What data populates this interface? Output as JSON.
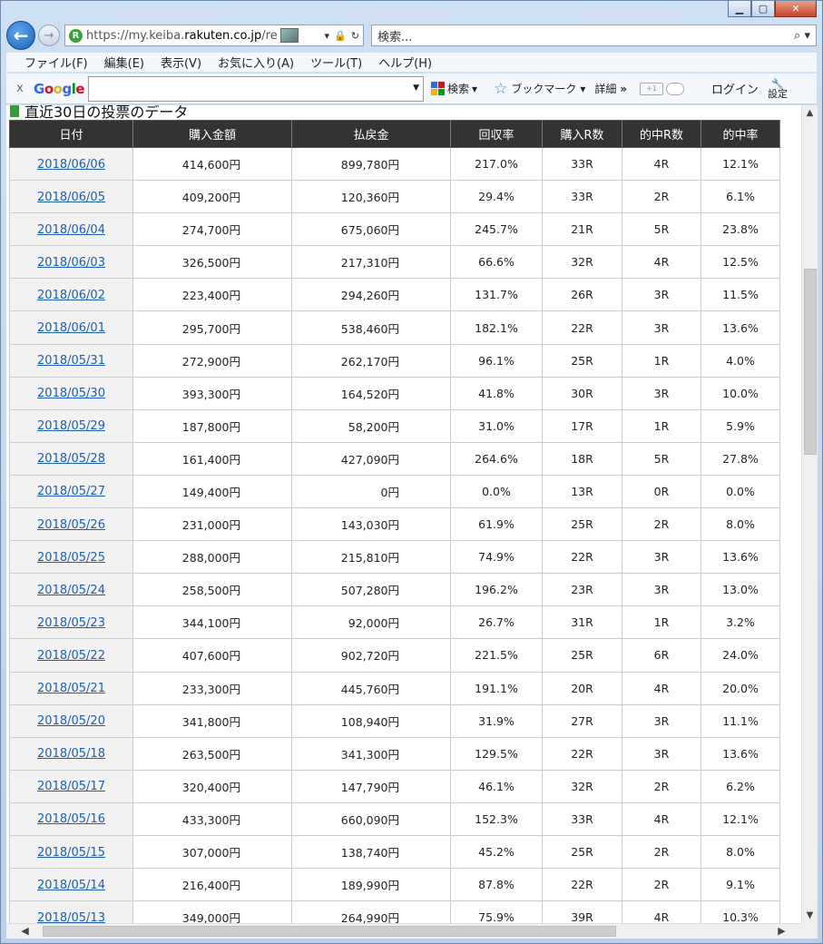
{
  "browser": {
    "url_prefix": "https://my.keiba.",
    "url_domain": "rakuten.co.jp",
    "url_suffix": "/rece",
    "search_placeholder": "検索...",
    "menu": [
      "ファイル(F)",
      "編集(E)",
      "表示(V)",
      "お気に入り(A)",
      "ツール(T)",
      "ヘルプ(H)"
    ],
    "toolbar": {
      "close": "x",
      "search_label": "検索",
      "bookmark_label": "ブックマーク",
      "details_label": "詳細",
      "more": "»",
      "plus_label": "+1",
      "login_label": "ログイン",
      "settings_label": "設定"
    }
  },
  "page": {
    "section_title": "直近30日の投票のデータ",
    "columns": [
      "日付",
      "購入金額",
      "払戻金",
      "回収率",
      "購入R数",
      "的中R数",
      "的中率"
    ],
    "rows": [
      [
        "2018/06/06",
        "414,600円",
        "899,780円",
        "217.0%",
        "33R",
        "4R",
        "12.1%"
      ],
      [
        "2018/06/05",
        "409,200円",
        "120,360円",
        "29.4%",
        "33R",
        "2R",
        "6.1%"
      ],
      [
        "2018/06/04",
        "274,700円",
        "675,060円",
        "245.7%",
        "21R",
        "5R",
        "23.8%"
      ],
      [
        "2018/06/03",
        "326,500円",
        "217,310円",
        "66.6%",
        "32R",
        "4R",
        "12.5%"
      ],
      [
        "2018/06/02",
        "223,400円",
        "294,260円",
        "131.7%",
        "26R",
        "3R",
        "11.5%"
      ],
      [
        "2018/06/01",
        "295,700円",
        "538,460円",
        "182.1%",
        "22R",
        "3R",
        "13.6%"
      ],
      [
        "2018/05/31",
        "272,900円",
        "262,170円",
        "96.1%",
        "25R",
        "1R",
        "4.0%"
      ],
      [
        "2018/05/30",
        "393,300円",
        "164,520円",
        "41.8%",
        "30R",
        "3R",
        "10.0%"
      ],
      [
        "2018/05/29",
        "187,800円",
        "58,200円",
        "31.0%",
        "17R",
        "1R",
        "5.9%"
      ],
      [
        "2018/05/28",
        "161,400円",
        "427,090円",
        "264.6%",
        "18R",
        "5R",
        "27.8%"
      ],
      [
        "2018/05/27",
        "149,400円",
        "0円",
        "0.0%",
        "13R",
        "0R",
        "0.0%"
      ],
      [
        "2018/05/26",
        "231,000円",
        "143,030円",
        "61.9%",
        "25R",
        "2R",
        "8.0%"
      ],
      [
        "2018/05/25",
        "288,000円",
        "215,810円",
        "74.9%",
        "22R",
        "3R",
        "13.6%"
      ],
      [
        "2018/05/24",
        "258,500円",
        "507,280円",
        "196.2%",
        "23R",
        "3R",
        "13.0%"
      ],
      [
        "2018/05/23",
        "344,100円",
        "92,000円",
        "26.7%",
        "31R",
        "1R",
        "3.2%"
      ],
      [
        "2018/05/22",
        "407,600円",
        "902,720円",
        "221.5%",
        "25R",
        "6R",
        "24.0%"
      ],
      [
        "2018/05/21",
        "233,300円",
        "445,760円",
        "191.1%",
        "20R",
        "4R",
        "20.0%"
      ],
      [
        "2018/05/20",
        "341,800円",
        "108,940円",
        "31.9%",
        "27R",
        "3R",
        "11.1%"
      ],
      [
        "2018/05/18",
        "263,500円",
        "341,300円",
        "129.5%",
        "22R",
        "3R",
        "13.6%"
      ],
      [
        "2018/05/17",
        "320,400円",
        "147,790円",
        "46.1%",
        "32R",
        "2R",
        "6.2%"
      ],
      [
        "2018/05/16",
        "433,300円",
        "660,090円",
        "152.3%",
        "33R",
        "4R",
        "12.1%"
      ],
      [
        "2018/05/15",
        "307,000円",
        "138,740円",
        "45.2%",
        "25R",
        "2R",
        "8.0%"
      ],
      [
        "2018/05/14",
        "216,400円",
        "189,990円",
        "87.8%",
        "22R",
        "2R",
        "9.1%"
      ],
      [
        "2018/05/13",
        "349,000円",
        "264,990円",
        "75.9%",
        "39R",
        "4R",
        "10.3%"
      ]
    ]
  }
}
